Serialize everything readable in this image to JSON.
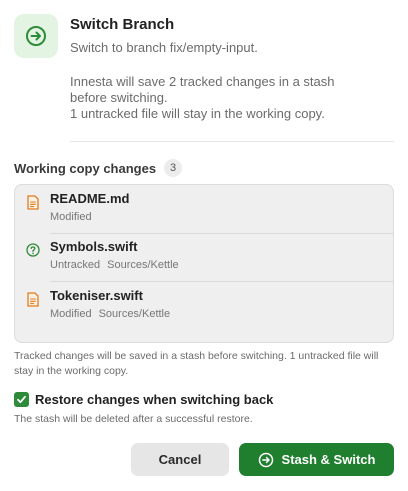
{
  "dialog": {
    "title": "Switch Branch",
    "subtitle": "Switch to branch fix/empty-input.",
    "description_line1": "Innesta will save 2 tracked changes in a stash",
    "description_line2": "before switching.",
    "description_line3": "1 untracked file will stay in the working copy."
  },
  "changes": {
    "label": "Working copy changes",
    "count": "3",
    "files": [
      {
        "name": "README.md",
        "status": "Modified",
        "path": "",
        "icon": "modified-file-icon"
      },
      {
        "name": "Symbols.swift",
        "status": "Untracked",
        "path": "Sources/Kettle",
        "icon": "untracked-question-icon"
      },
      {
        "name": "Tokeniser.swift",
        "status": "Modified",
        "path": "Sources/Kettle",
        "icon": "modified-file-icon"
      }
    ]
  },
  "note": "Tracked changes will be saved in a stash before switching. 1 untracked file will stay in the working copy.",
  "restore": {
    "checked": true,
    "label": "Restore changes when switching back",
    "hint": "The stash will be deleted after a successful restore."
  },
  "buttons": {
    "cancel": "Cancel",
    "primary": "Stash & Switch"
  },
  "colors": {
    "accent": "#1f7f2e",
    "icon_bg": "#e4f4e3",
    "modified": "#e07b1f",
    "untracked": "#2e8b39"
  }
}
